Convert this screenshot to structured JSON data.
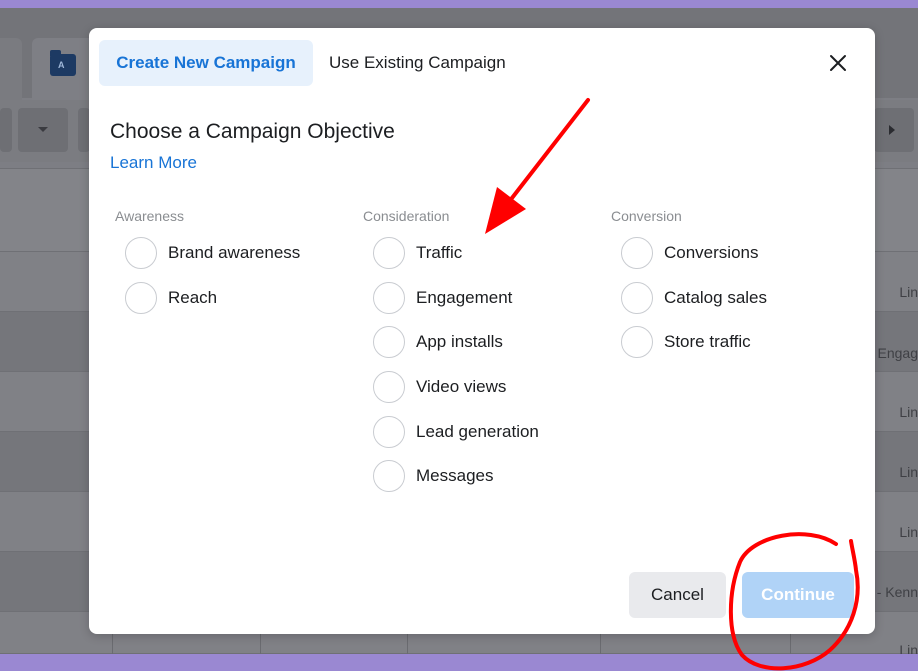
{
  "modal": {
    "tabs": [
      {
        "label": "Create New Campaign",
        "active": true
      },
      {
        "label": "Use Existing Campaign",
        "active": false
      }
    ],
    "title": "Choose a Campaign Objective",
    "learn_more": "Learn More",
    "columns": [
      {
        "heading": "Awareness",
        "options": [
          "Brand awareness",
          "Reach"
        ]
      },
      {
        "heading": "Consideration",
        "options": [
          "Traffic",
          "Engagement",
          "App installs",
          "Video views",
          "Lead generation",
          "Messages"
        ]
      },
      {
        "heading": "Conversion",
        "options": [
          "Conversions",
          "Catalog sales",
          "Store traffic"
        ]
      }
    ],
    "cancel_label": "Cancel",
    "continue_label": "Continue"
  },
  "background": {
    "row_texts": [
      "Lin",
      "Engag",
      "Lin",
      "Lin",
      "Lin",
      "- Kenn",
      "Lin"
    ]
  },
  "colors": {
    "accent": "#1874d6",
    "active_tab_bg": "#e7f1fc",
    "continue_disabled": "#b0d3f7",
    "annotation": "#ff0000",
    "frame": "#9a88d2"
  },
  "icons": {
    "close": "close-icon",
    "folder": "folder-icon",
    "dropdown": "chevron-down-icon",
    "play": "play-icon"
  }
}
